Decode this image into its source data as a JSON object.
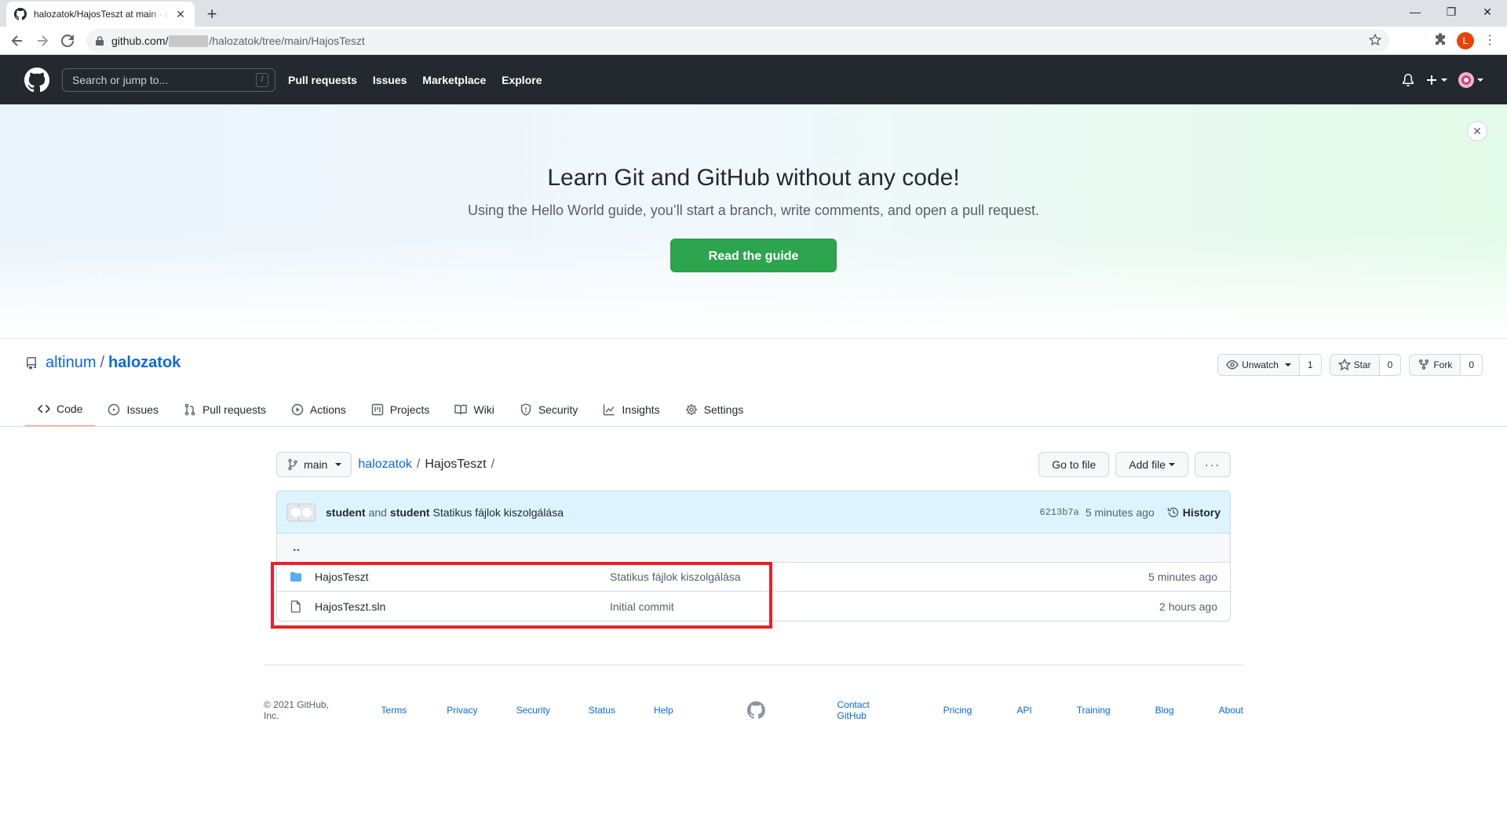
{
  "browser": {
    "tab_title": "halozatok/HajosTeszt at main · altinum",
    "url_prefix": "github.com/",
    "url_suffix": "/halozatok/tree/main/HajosTeszt",
    "profile_initial": "L"
  },
  "header": {
    "search_placeholder": "Search or jump to...",
    "search_shortcut": "/",
    "nav": [
      "Pull requests",
      "Issues",
      "Marketplace",
      "Explore"
    ]
  },
  "banner": {
    "title": "Learn Git and GitHub without any code!",
    "subtitle": "Using the Hello World guide, you’ll start a branch, write comments, and open a pull request.",
    "button": "Read the guide"
  },
  "repo": {
    "owner": "altinum",
    "separator": "/",
    "name": "halozatok",
    "watch_label": "Unwatch",
    "watch_count": "1",
    "star_label": "Star",
    "star_count": "0",
    "fork_label": "Fork",
    "fork_count": "0"
  },
  "tabs": [
    {
      "label": "Code",
      "icon": "code-icon",
      "active": true
    },
    {
      "label": "Issues",
      "icon": "issue-icon"
    },
    {
      "label": "Pull requests",
      "icon": "pull-request-icon"
    },
    {
      "label": "Actions",
      "icon": "play-icon"
    },
    {
      "label": "Projects",
      "icon": "project-icon"
    },
    {
      "label": "Wiki",
      "icon": "book-icon"
    },
    {
      "label": "Security",
      "icon": "shield-icon"
    },
    {
      "label": "Insights",
      "icon": "graph-icon"
    },
    {
      "label": "Settings",
      "icon": "gear-icon"
    }
  ],
  "file_nav": {
    "branch": "main",
    "crumb_repo": "halozatok",
    "crumb_dir": "HajosTeszt",
    "slash": "/",
    "go_to_file": "Go to file",
    "add_file": "Add file",
    "more": "···"
  },
  "commit": {
    "author1": "student",
    "and": "and",
    "author2": "student",
    "message": "Statikus fájlok kiszolgálása",
    "sha": "6213b7a",
    "age": "5 minutes ago",
    "history": "History"
  },
  "files": {
    "up": "..",
    "rows": [
      {
        "name": "HajosTeszt",
        "type": "folder",
        "message": "Statikus fájlok kiszolgálása",
        "age": "5 minutes ago"
      },
      {
        "name": "HajosTeszt.sln",
        "type": "file",
        "message": "Initial commit",
        "age": "2 hours ago"
      }
    ]
  },
  "footer": {
    "copyright": "© 2021 GitHub, Inc.",
    "left_links": [
      "Terms",
      "Privacy",
      "Security",
      "Status",
      "Help"
    ],
    "right_links": [
      "Contact GitHub",
      "Pricing",
      "API",
      "Training",
      "Blog",
      "About"
    ]
  },
  "colors": {
    "accent": "#0969da",
    "primary_button": "#2da44e",
    "header_bg": "#24292f",
    "highlight_box": "#e8202a"
  }
}
